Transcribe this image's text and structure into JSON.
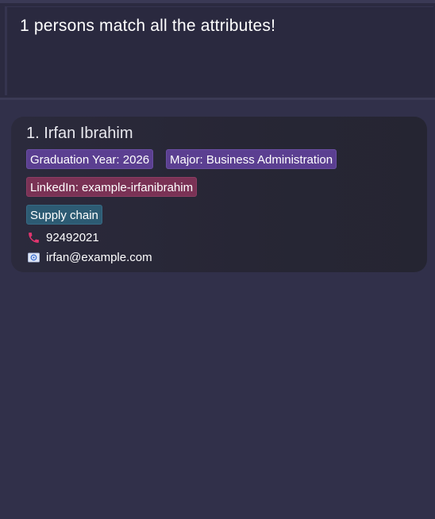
{
  "result": {
    "message": "1 persons match all the attributes!"
  },
  "persons": [
    {
      "name": "1. Irfan Ibrahim",
      "graduation_year": "Graduation Year: 2026",
      "major": "Major: Business Administration",
      "linkedin": "LinkedIn: example-irfanibrahim",
      "tag": "Supply chain",
      "phone": "92492021",
      "email": "irfan@example.com",
      "phone_icon": "phone-icon",
      "email_icon": "email-icon"
    }
  ],
  "colors": {
    "background": "#31304a",
    "card": "#272635",
    "tag_purple": "#5b3f91",
    "tag_pink": "#7a3255",
    "tag_teal": "#2d5b73",
    "phone_icon": "#e0356e"
  }
}
